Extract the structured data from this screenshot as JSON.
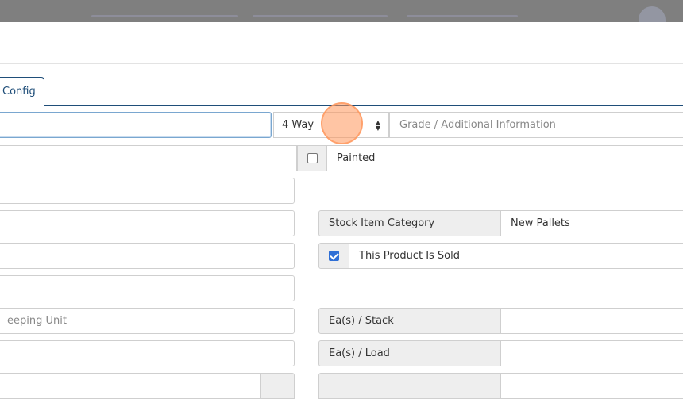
{
  "topbar": {
    "ghost_items": [
      "",
      "",
      "",
      ""
    ]
  },
  "tabs": {
    "active_label": "Config"
  },
  "form": {
    "pallet_name_value": "",
    "entry_type_select": "4 Way",
    "grade_placeholder": "Grade / Additional Information",
    "painted_label": "Painted",
    "stock_item_category_label": "Stock Item Category",
    "stock_item_category_value": "New Pallets",
    "product_sold_label": "This Product Is Sold",
    "sku_placeholder": "eeping Unit",
    "ea_stack_label": "Ea(s) / Stack",
    "ea_load_label": "Ea(s) / Load"
  },
  "colors": {
    "accent": "#1f4e79",
    "checkbox_checked": "#2f6fd6",
    "cursor_highlight": "#ff965a"
  }
}
